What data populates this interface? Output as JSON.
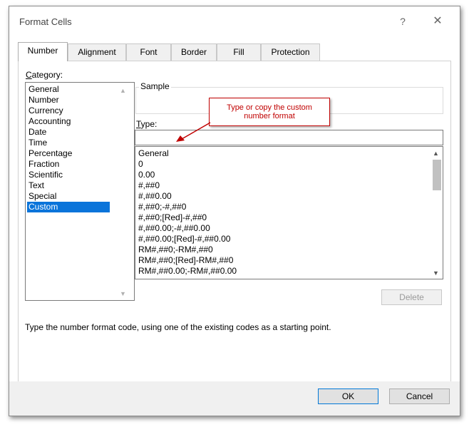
{
  "dialog": {
    "title": "Format Cells",
    "help_glyph": "?",
    "close_glyph": "✕"
  },
  "tabs": [
    {
      "label": "Number",
      "active": true
    },
    {
      "label": "Alignment"
    },
    {
      "label": "Font"
    },
    {
      "label": "Border"
    },
    {
      "label": "Fill"
    },
    {
      "label": "Protection"
    }
  ],
  "category": {
    "label_first": "C",
    "label_rest": "ategory:",
    "items": [
      "General",
      "Number",
      "Currency",
      "Accounting",
      "Date",
      "Time",
      "Percentage",
      "Fraction",
      "Scientific",
      "Text",
      "Special",
      "Custom"
    ],
    "selected": "Custom"
  },
  "sample": {
    "label": "Sample",
    "value": ""
  },
  "type": {
    "label_first": "T",
    "label_rest": "ype:",
    "value": ""
  },
  "formats": [
    "General",
    "0",
    "0.00",
    "#,##0",
    "#,##0.00",
    "#,##0;-#,##0",
    "#,##0;[Red]-#,##0",
    "#,##0.00;-#,##0.00",
    "#,##0.00;[Red]-#,##0.00",
    "RM#,##0;-RM#,##0",
    "RM#,##0;[Red]-RM#,##0",
    "RM#,##0.00;-RM#,##0.00"
  ],
  "callout": {
    "line1": "Type or copy the custom",
    "line2": "number format"
  },
  "buttons": {
    "delete": "Delete",
    "ok": "OK",
    "cancel": "Cancel"
  },
  "hint": "Type the number format code, using one of the existing codes as a starting point.",
  "colors": {
    "selection": "#0a74da",
    "callout": "#c00000"
  }
}
